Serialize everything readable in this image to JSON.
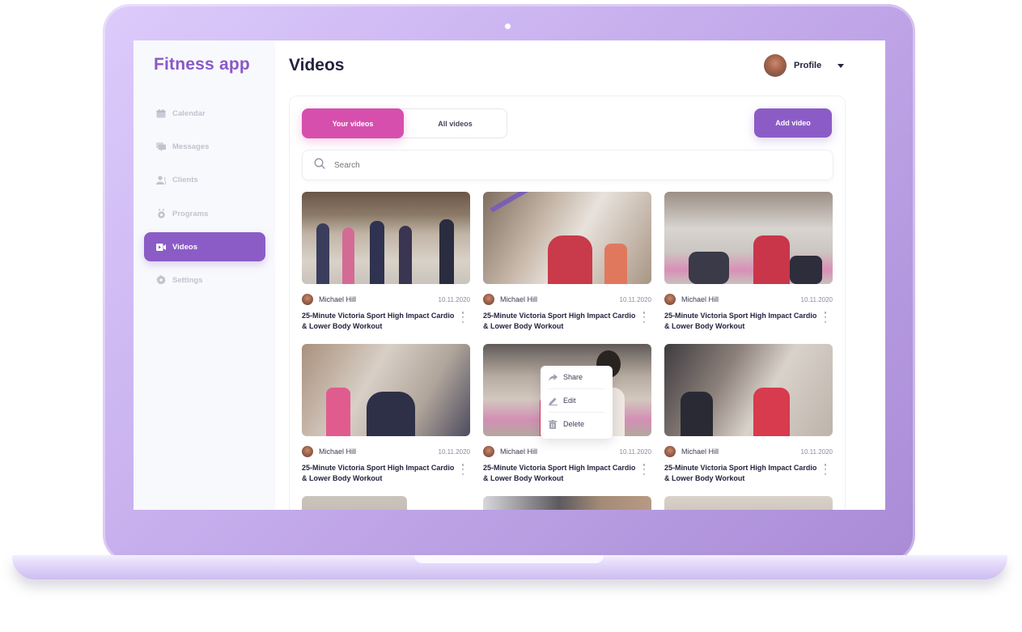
{
  "app": {
    "title": "Fitness app"
  },
  "sidebar": {
    "items": [
      {
        "label": "Calendar",
        "icon": "calendar-icon",
        "active": false
      },
      {
        "label": "Messages",
        "icon": "messages-icon",
        "active": false
      },
      {
        "label": "Clients",
        "icon": "clients-icon",
        "active": false
      },
      {
        "label": "Programs",
        "icon": "programs-icon",
        "active": false
      },
      {
        "label": "Videos",
        "icon": "video-camera-icon",
        "active": true
      },
      {
        "label": "Settings",
        "icon": "gear-icon",
        "active": false
      }
    ]
  },
  "header": {
    "title": "Videos",
    "profile_label": "Profile"
  },
  "toolbar": {
    "tabs": [
      {
        "label": "Your videos",
        "active": true
      },
      {
        "label": "All videos",
        "active": false
      }
    ],
    "add_label": "Add video"
  },
  "search": {
    "placeholder": "Search",
    "value": ""
  },
  "videos": [
    {
      "author": "Michael Hill",
      "date": "10.11.2020",
      "title": "25-Minute Victoria Sport High Impact Cardio & Lower Body Workout"
    },
    {
      "author": "Michael Hill",
      "date": "10.11.2020",
      "title": "25-Minute Victoria Sport High Impact Cardio & Lower Body Workout"
    },
    {
      "author": "Michael Hill",
      "date": "10.11.2020",
      "title": "25-Minute Victoria Sport High Impact Cardio & Lower Body Workout"
    },
    {
      "author": "Michael Hill",
      "date": "10.11.2020",
      "title": "25-Minute Victoria Sport High Impact Cardio & Lower Body Workout"
    },
    {
      "author": "Michael Hill",
      "date": "10.11.2020",
      "title": "25-Minute Victoria Sport High Impact Cardio & Lower Body Workout"
    },
    {
      "author": "Michael Hill",
      "date": "10.11.2020",
      "title": "25-Minute Victoria Sport High Impact Cardio & Lower Body Workout"
    }
  ],
  "context_menu": {
    "items": [
      {
        "label": "Share",
        "icon": "share-icon"
      },
      {
        "label": "Edit",
        "icon": "edit-icon"
      },
      {
        "label": "Delete",
        "icon": "trash-icon"
      }
    ]
  },
  "colors": {
    "brand": "#8a58c7",
    "active_nav": "#8b5cc6",
    "active_tab": "#d64fad",
    "text_dark": "#23233f",
    "laptop_frame": "#b89de6"
  }
}
